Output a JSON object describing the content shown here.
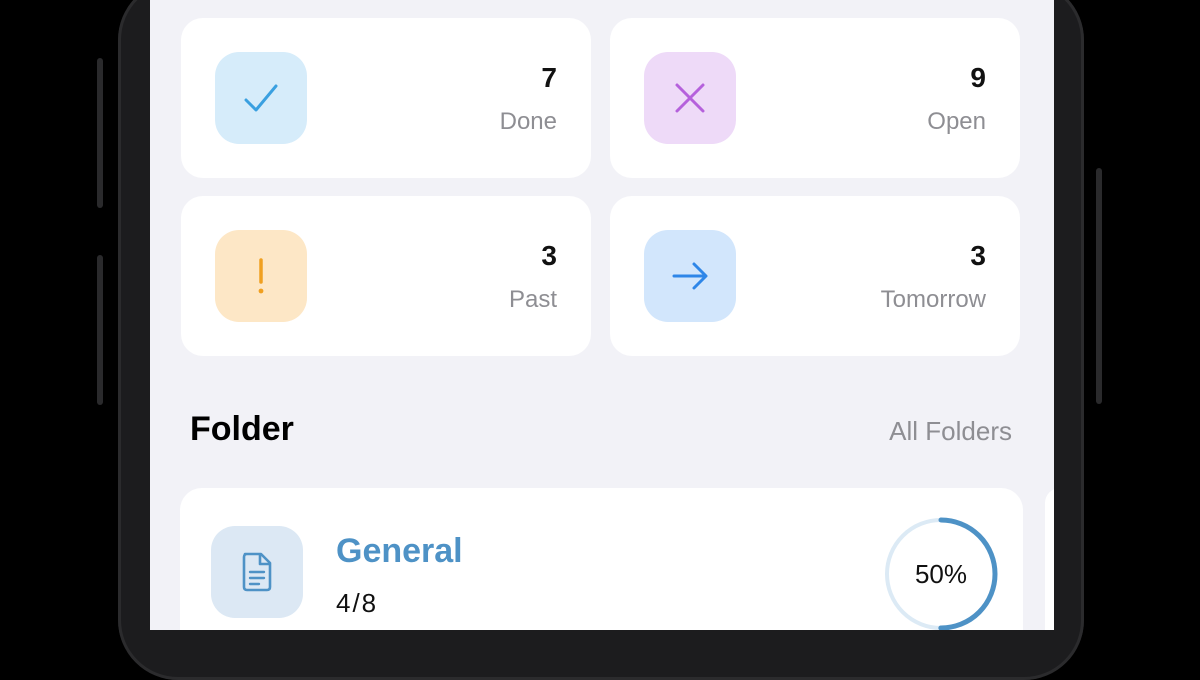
{
  "stats": [
    {
      "icon": "checkmark-icon",
      "count": "7",
      "label": "Done",
      "icon_bg": "#d6ecfa",
      "icon_color": "#3aa0e0"
    },
    {
      "icon": "x-mark-icon",
      "count": "9",
      "label": "Open",
      "icon_bg": "#eedaf8",
      "icon_color": "#b561dc"
    },
    {
      "icon": "exclamation-icon",
      "count": "3",
      "label": "Past",
      "icon_bg": "#fde7c6",
      "icon_color": "#f0a020"
    },
    {
      "icon": "arrow-right-icon",
      "count": "3",
      "label": "Tomorrow",
      "icon_bg": "#d2e6fc",
      "icon_color": "#2e86e8"
    }
  ],
  "folder_section": {
    "title": "Folder",
    "link": "All Folders"
  },
  "folders": [
    {
      "icon": "document-icon",
      "name": "General",
      "count": "4/8",
      "progress_text": "50%",
      "progress": 0.5,
      "accent": "#4e92c6"
    }
  ],
  "colors": {
    "background": "#f2f2f7",
    "card": "#ffffff",
    "secondary_text": "#8e8e93"
  }
}
